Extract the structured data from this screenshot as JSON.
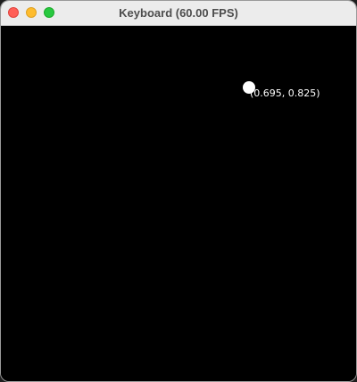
{
  "window": {
    "title": "Keyboard (60.00 FPS)"
  },
  "canvas": {
    "background_color": "#000000",
    "point_color": "#ffffff",
    "point_label": "(0.695, 0.825)"
  },
  "traffic_lights": {
    "close_color": "#ff5f57",
    "minimize_color": "#febc2e",
    "zoom_color": "#28c840"
  }
}
